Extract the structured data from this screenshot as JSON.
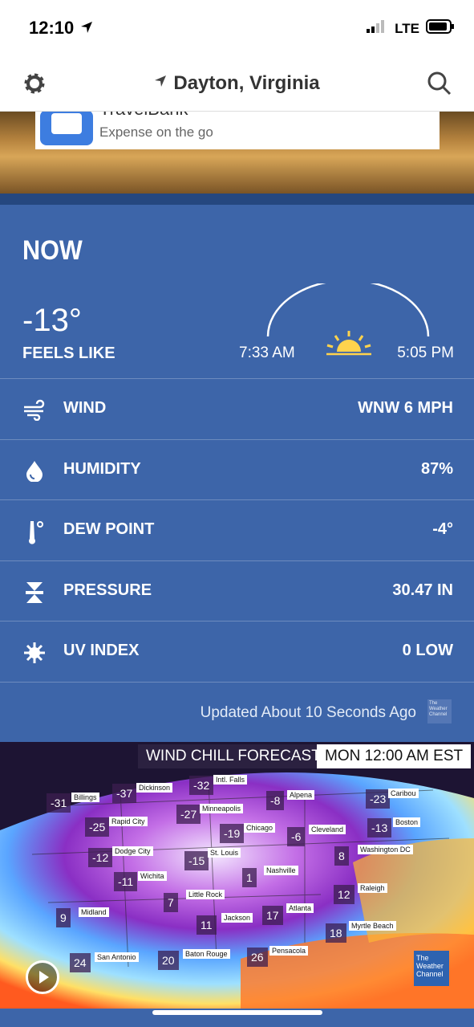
{
  "status_bar": {
    "time": "12:10",
    "network": "LTE"
  },
  "nav": {
    "location": "Dayton, Virginia"
  },
  "ad": {
    "title": "TravelBank",
    "subtitle": "Expense on the go"
  },
  "now": {
    "heading": "NOW",
    "temperature": "-13°",
    "feels_like_label": "FEELS LIKE",
    "sunrise": "7:33 AM",
    "sunset": "5:05 PM"
  },
  "conditions": [
    {
      "icon": "wind-icon",
      "label": "WIND",
      "value": "WNW 6 MPH"
    },
    {
      "icon": "humidity-icon",
      "label": "HUMIDITY",
      "value": "87%"
    },
    {
      "icon": "thermometer-icon",
      "label": "DEW POINT",
      "value": "-4°"
    },
    {
      "icon": "pressure-icon",
      "label": "PRESSURE",
      "value": "30.47 IN"
    },
    {
      "icon": "uv-icon",
      "label": "UV INDEX",
      "value": "0 LOW"
    }
  ],
  "updated": "Updated About 10 Seconds Ago",
  "map": {
    "title": "WIND CHILL FORECAST",
    "time": "MON 12:00 AM EST",
    "logo": "The Weather Channel",
    "cities": [
      {
        "name": "Billings",
        "temp": "-31"
      },
      {
        "name": "Dickinson",
        "temp": "-37"
      },
      {
        "name": "Intl. Falls",
        "temp": "-32"
      },
      {
        "name": "Minneapolis",
        "temp": "-27"
      },
      {
        "name": "Alpena",
        "temp": "-8"
      },
      {
        "name": "Caribou",
        "temp": "-23"
      },
      {
        "name": "Rapid City",
        "temp": "-25"
      },
      {
        "name": "Chicago",
        "temp": "-19"
      },
      {
        "name": "Cleveland",
        "temp": "-6"
      },
      {
        "name": "Boston",
        "temp": "-13"
      },
      {
        "name": "Dodge City",
        "temp": "-12"
      },
      {
        "name": "St. Louis",
        "temp": "-15"
      },
      {
        "name": "Washington DC",
        "temp": "8"
      },
      {
        "name": "Wichita",
        "temp": "-11"
      },
      {
        "name": "Nashville",
        "temp": "1"
      },
      {
        "name": "Little Rock",
        "temp": "7"
      },
      {
        "name": "Raleigh",
        "temp": "12"
      },
      {
        "name": "Midland",
        "temp": "9"
      },
      {
        "name": "Jackson",
        "temp": "11"
      },
      {
        "name": "Atlanta",
        "temp": "17"
      },
      {
        "name": "Myrtle Beach",
        "temp": "18"
      },
      {
        "name": "San Antonio",
        "temp": "24"
      },
      {
        "name": "Baton Rouge",
        "temp": "20"
      },
      {
        "name": "Pensacola",
        "temp": "26"
      }
    ]
  }
}
